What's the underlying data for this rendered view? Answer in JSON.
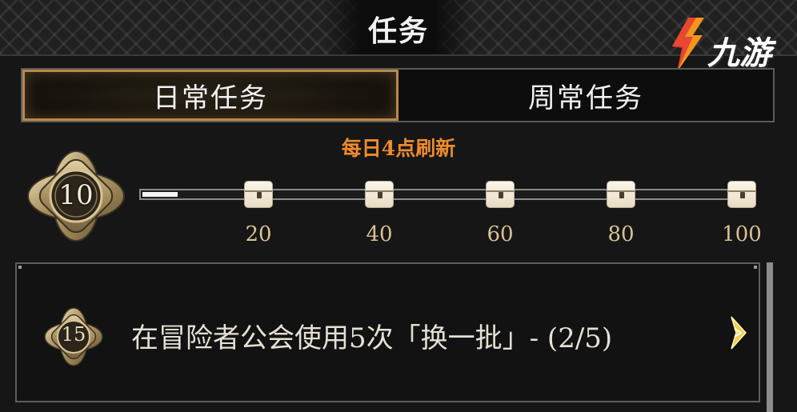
{
  "header": {
    "title": "任务"
  },
  "brand": {
    "logo_text": "九游",
    "colors": {
      "orange": "#f7941d",
      "red": "#e53935"
    }
  },
  "tabs": [
    {
      "label": "日常任务",
      "selected": true
    },
    {
      "label": "周常任务",
      "selected": false
    }
  ],
  "refresh_notice": "每日4点刷新",
  "progress": {
    "current": "10",
    "max": 100,
    "milestones": [
      "20",
      "40",
      "60",
      "80",
      "100"
    ]
  },
  "quest": {
    "points": "15",
    "text": "在冒险者公会使用5次「换一批」- (2/5)"
  },
  "colors": {
    "accent_orange": "#ee8a2e",
    "milestone_gold": "#d9c292",
    "selected_tab_border": "#b8894b"
  },
  "icons": [
    "ornate-badge-icon",
    "chest-icon",
    "arrow-right-icon"
  ]
}
